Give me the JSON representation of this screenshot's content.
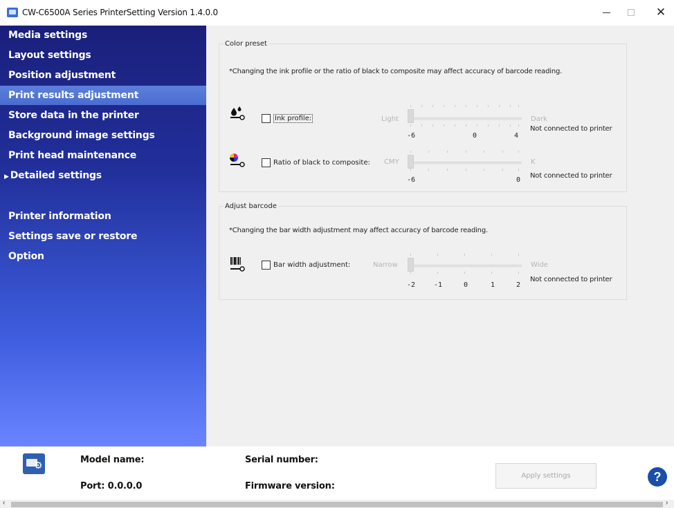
{
  "window": {
    "title": "CW-C6500A Series PrinterSetting Version 1.4.0.0",
    "minimize_glyph": "—",
    "maximize_glyph": "☐",
    "close_glyph": "✕"
  },
  "sidebar": {
    "selected_item": "Print results adjustment",
    "items": [
      {
        "label": "Media settings"
      },
      {
        "label": "Layout settings"
      },
      {
        "label": "Position adjustment"
      },
      {
        "label": "Print results adjustment"
      },
      {
        "label": "Store data in the printer"
      },
      {
        "label": "Background image settings"
      },
      {
        "label": "Print head maintenance"
      },
      {
        "label": "Detailed settings",
        "expand_glyph": "▶"
      },
      {
        "label": "Printer information"
      },
      {
        "label": "Settings save or restore"
      },
      {
        "label": "Option"
      }
    ]
  },
  "color_preset": {
    "legend": "Color preset",
    "note": "*Changing the ink profile or the ratio of black to composite may affect accuracy of barcode reading.",
    "ink_profile": {
      "icon": "ink-drops-icon",
      "label": "Ink profile:",
      "checked": false,
      "min_label": "Light",
      "max_label": "Dark",
      "tick_labels": [
        "-6",
        "0",
        "4"
      ],
      "value": -6,
      "range": [
        -6,
        4
      ],
      "status": "Not connected to printer"
    },
    "ratio": {
      "icon": "color-ball-icon",
      "label": "Ratio of black to composite:",
      "checked": false,
      "min_label": "CMY",
      "max_label": "K",
      "tick_labels": [
        "-6",
        "0"
      ],
      "value": -6,
      "range": [
        -6,
        0
      ],
      "status": "Not connected to printer"
    }
  },
  "adjust_barcode": {
    "legend": "Adjust barcode",
    "note": "*Changing the bar width adjustment may affect accuracy of barcode reading.",
    "bar_width": {
      "icon": "barcode-icon",
      "label": "Bar width adjustment:",
      "checked": false,
      "min_label": "Narrow",
      "max_label": "Wide",
      "tick_labels": [
        "-2",
        "-1",
        "0",
        "1",
        "2"
      ],
      "value": -2,
      "range": [
        -2,
        2
      ],
      "status": "Not connected to printer"
    }
  },
  "footer": {
    "model_label": "Model name:",
    "port_label": "Port: 0.0.0.0",
    "serial_label": "Serial number:",
    "firmware_label": "Firmware version:",
    "apply_button": "Apply settings",
    "help_glyph": "?"
  },
  "scrollbar": {
    "left_glyph": "‹",
    "right_glyph": "›"
  },
  "colors": {
    "sidebar_top": "#1a1f7a",
    "sidebar_bottom": "#6a84ff",
    "selected_item": "#5d80dc",
    "help_blue": "#1a4ea8"
  }
}
